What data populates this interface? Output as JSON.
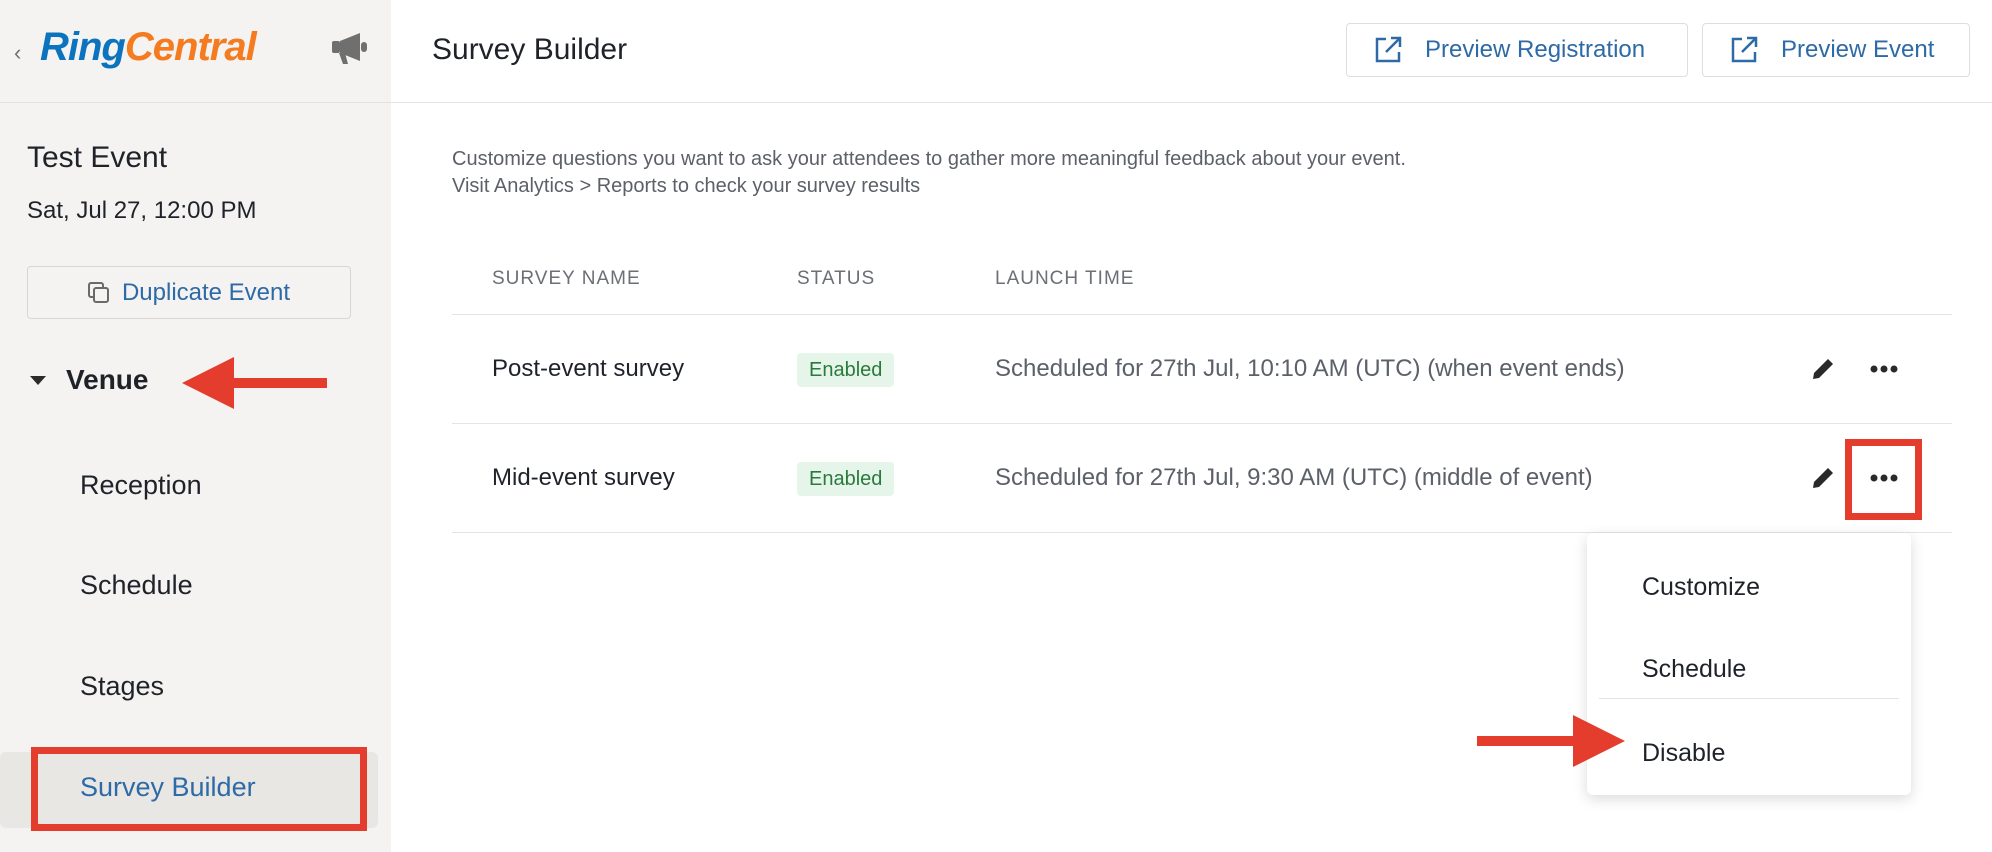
{
  "brand": {
    "logo_part1": "Ring",
    "logo_part2": "Central"
  },
  "event": {
    "title": "Test Event",
    "date": "Sat, Jul 27, 12:00 PM",
    "duplicate_label": "Duplicate Event"
  },
  "sidebar": {
    "section_label": "Venue",
    "items": [
      {
        "label": "Reception"
      },
      {
        "label": "Schedule"
      },
      {
        "label": "Stages"
      },
      {
        "label": "Survey Builder"
      }
    ]
  },
  "header": {
    "title": "Survey Builder",
    "preview_registration": "Preview Registration",
    "preview_event": "Preview Event"
  },
  "intro": {
    "line1": "Customize questions you want to ask your attendees to gather more meaningful feedback about your event.",
    "line2": "Visit Analytics > Reports to check your survey results"
  },
  "table": {
    "columns": [
      "SURVEY NAME",
      "STATUS",
      "LAUNCH TIME"
    ],
    "rows": [
      {
        "name": "Post-event survey",
        "status": "Enabled",
        "launch_time": "Scheduled for 27th Jul, 10:10 AM (UTC) (when event ends)"
      },
      {
        "name": "Mid-event survey",
        "status": "Enabled",
        "launch_time": "Scheduled for 27th Jul, 9:30 AM (UTC) (middle of event)"
      }
    ]
  },
  "menu": {
    "items": [
      "Customize",
      "Schedule",
      "Disable"
    ]
  },
  "colors": {
    "accent": "#2d6aa6",
    "annotation_red": "#e53d2d",
    "status_green": "#2a7a3c"
  }
}
